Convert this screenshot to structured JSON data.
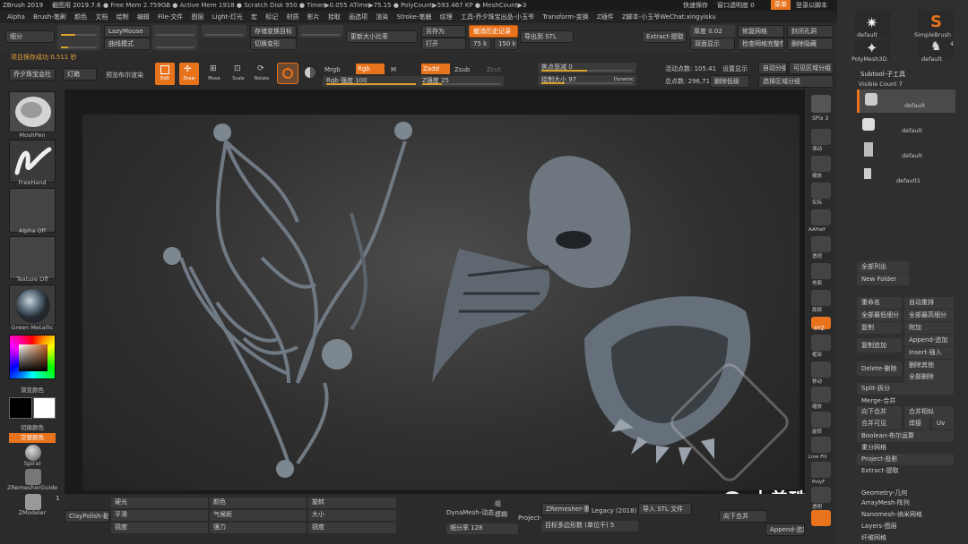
{
  "titlebar": {
    "app": "ZBrush 2019",
    "version": "截图用 2019.7.6",
    "stats": "● Free Mem 2.759GB ● Active Mem 1918 ● Scratch Disk 950 ● Timer▶0.055 ATime▶75.15 ● PolyCount▶593.467 KP ● MeshCount▶3",
    "quicksave": "快速保存",
    "transparency": "窗口透明度 0",
    "menu": "菜单",
    "login": "登录以脚本"
  },
  "menubar": {
    "items": [
      "Alpha",
      "Brush-笔刷",
      "颜色",
      "文档",
      "绘制",
      "编辑",
      "File-文件",
      "图层",
      "Light-灯光",
      "宏",
      "标记",
      "材质",
      "影片",
      "拾取",
      "画选项",
      "渲染",
      "Stroke-笔触",
      "纹理",
      "工具-乔夕珠宝出品-小玉爷",
      "Transform-变换",
      "Z插件",
      "Z脚本-小玉爷WeChat:xingyisku"
    ]
  },
  "toolrow1": {
    "subdivide": "细分",
    "lazy": "LazyMouse",
    "curve": "曲线模式",
    "store": "存储变换目标",
    "switch": "切换变形",
    "update": "更新大小比率",
    "saveas": "另存为",
    "history": "撤消历史记录",
    "open": "打开",
    "export_stl": "导出到 STL",
    "size75": "75 k",
    "size150": "150 k",
    "extract": "Extract-提取",
    "thickness": "厚度 0.02",
    "fix_mesh": "修复网格",
    "close_hole": "封闭孔洞",
    "double": "双面显示",
    "check": "检查网格完整性",
    "delete_hidden": "删除隐藏"
  },
  "toolrow2": {
    "local": "项目保存成功 0.511 秒",
    "jewel": "乔夕珠宝会社",
    "light": "灯箱",
    "preview": "预览布尔渲染",
    "edit": "Edit",
    "draw": "Draw",
    "move": "Move",
    "scale": "Scale",
    "rotate": "Rotate",
    "mrgb": "Mrgb",
    "rgb": "Rgb",
    "m": "M",
    "rgb_intensity": "Rgb 强度 100",
    "zadd": "Zadd",
    "zsub": "Zsub",
    "zcut": "Zcut",
    "z_intensity": "Z强度 25",
    "focal": "焦点衰减 0",
    "draw_size": "绘制大小 97",
    "dynamic": "Dynamic",
    "active_points": "活动点数: 105.41",
    "total_points": "总点数: 296,713",
    "sym": "设置显示",
    "del_low": "删除低级",
    "auto_group": "自动分组",
    "visible_group": "可见区域分组",
    "polygroup": "选择区域分组"
  },
  "leftpanel": {
    "brush1": "MoshPen",
    "brush2": "FreeHand",
    "alpha": "Alpha Off",
    "texture": "Texture Off",
    "material": "Green Metallic",
    "main_color": "渐变颜色",
    "switch_color": "切换颜色",
    "alt_color": "交替颜色",
    "spiral": "Spiral",
    "zremesher": "ZRemesherGuide",
    "zmodeler": "ZModeler",
    "zmodeler_count": "1"
  },
  "rightstrip": {
    "spix": "SPix 3",
    "labels": [
      "滚动",
      "缩放",
      "实际",
      "AAHalf",
      "透视",
      "地面",
      "局部",
      "XYZ",
      "框架",
      "移动",
      "缩放",
      "旋转",
      "Line Fill",
      "PolyF",
      "透明"
    ]
  },
  "subtool": {
    "brushes": [
      "default",
      "SimpleBrush",
      "PolyMesh3D",
      "default"
    ],
    "brush_count": "4",
    "title": "Subtool-子工具",
    "visible": "Visible Count 7",
    "items": [
      "default",
      "default",
      "default",
      "default1"
    ],
    "list_all": "全部列出",
    "new_folder": "New Folder",
    "rename": "重命名",
    "auto_reorder": "自动重排",
    "all_low": "全部最低细分",
    "all_high": "全部最高细分",
    "duplicate": "复制",
    "mirror": "附加",
    "copy_append": "复制追加",
    "append": "Append-追加",
    "insert": "Insert-插入",
    "delete": "Delete-删除",
    "del_other": "删除其他",
    "del_all": "全部删除",
    "split": "Split-拆分",
    "merge": "Merge-合并",
    "merge_down": "向下合并",
    "merge_similar": "合并相似",
    "merge_visible": "合并可见",
    "weld": "焊接",
    "uv": "Uv",
    "boolean": "Boolean-布尔运算",
    "remesh": "重分网格",
    "project": "Project-投影",
    "extract": "Extract-提取",
    "geometry": "Geometry-几何",
    "array_mesh": "ArrayMesh-阵列",
    "nanomesh": "Nanomesh-纳米网格",
    "layers": "Layers-图层",
    "fibermesh": "纤维网格"
  },
  "bottom": {
    "clay": "ClayPolish-黏土",
    "s1": "硬光",
    "s2": "平滑",
    "s3": "锐度",
    "s4": "颜色",
    "s5": "气候距",
    "s6": "强力",
    "s7": "旋转",
    "s8": "大小",
    "s9": "锐度",
    "dynamesh": "DynaMesh-动态",
    "blur": "模糊",
    "project": "Project-",
    "group": "组",
    "sub": "细分率 128",
    "zremesher": "ZRemesher-重新",
    "legacy": "Legacy (2018)",
    "target": "目标多边形数 (单位千) 5",
    "stl": "导入 STL 文件",
    "merge_down": "向下合并",
    "append": "Append-追加"
  },
  "watermark": {
    "name": "大曾珠宝工作室"
  }
}
